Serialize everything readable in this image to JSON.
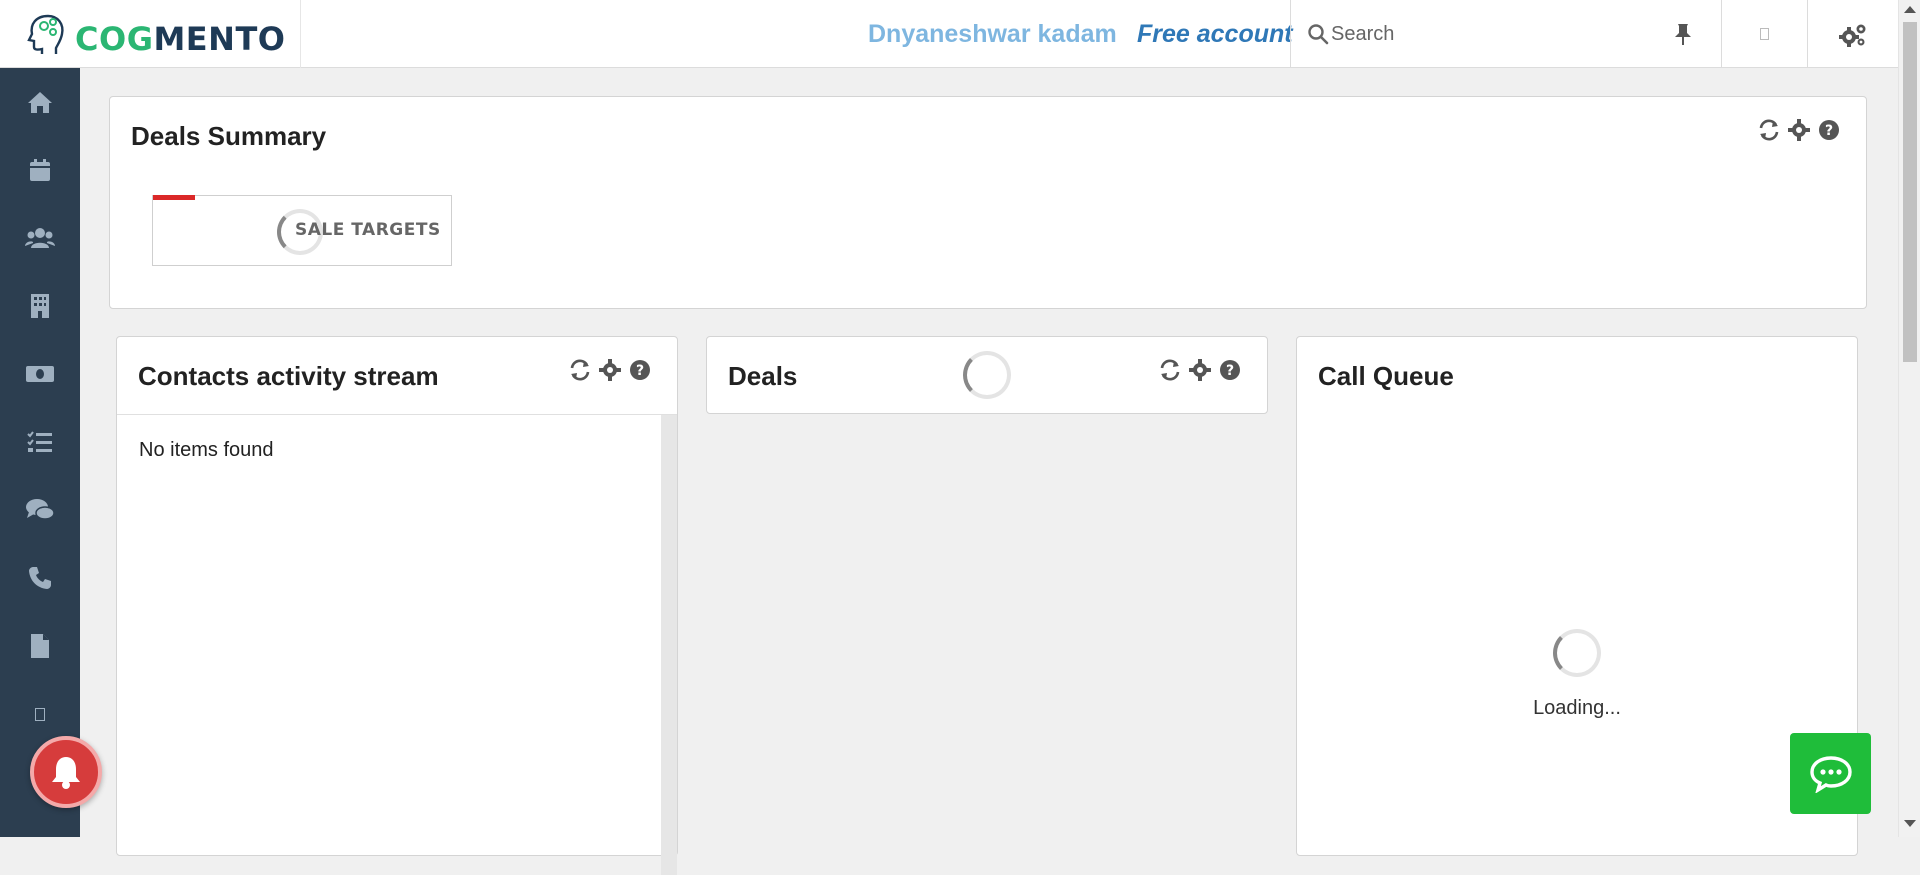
{
  "header": {
    "brand_part1": "COG",
    "brand_part2": "MENTO",
    "username": "Dnyaneshwar kadam",
    "account_type": "Free account",
    "search_placeholder": "Search"
  },
  "sidebar": {
    "items": [
      {
        "icon": "home-icon"
      },
      {
        "icon": "calendar-icon"
      },
      {
        "icon": "contacts-icon"
      },
      {
        "icon": "companies-icon"
      },
      {
        "icon": "deals-icon"
      },
      {
        "icon": "tasks-icon"
      },
      {
        "icon": "chat-icon"
      },
      {
        "icon": "phone-icon"
      },
      {
        "icon": "documents-icon"
      },
      {
        "icon": "square-icon"
      }
    ]
  },
  "deals_summary": {
    "title": "Deals Summary",
    "card_label": "SALE TARGETS"
  },
  "contacts_panel": {
    "title": "Contacts activity stream",
    "empty_text": "No items found"
  },
  "deals_panel": {
    "title": "Deals"
  },
  "call_queue": {
    "title": "Call Queue",
    "loading_text": "Loading..."
  },
  "colors": {
    "brand_green": "#2bb673",
    "brand_navy": "#1e3a56",
    "sidebar_bg": "#2c3e50",
    "username": "#7eb6e0",
    "account": "#2f78b7",
    "alert_red": "#db2828",
    "chat_green": "#1fbd3a"
  }
}
